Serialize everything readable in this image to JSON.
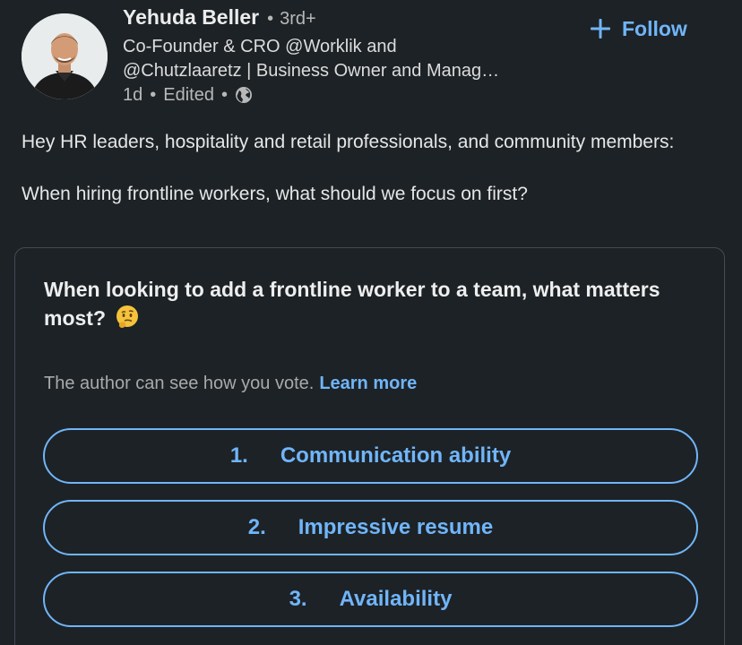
{
  "author": {
    "name": "Yehuda Beller",
    "degree_separator": "•",
    "degree": "3rd+",
    "headline_line1": "Co-Founder & CRO @Worklik and",
    "headline_line2": "@Chutzlaaretz | Business Owner and Manag…",
    "time": "1d",
    "edited": "Edited",
    "meta_separator": "•",
    "visibility_icon": "globe-icon"
  },
  "follow": {
    "label": "Follow",
    "icon": "plus-icon"
  },
  "post": {
    "line1": "Hey HR leaders, hospitality and retail professionals, and community members:",
    "line2": "When hiring frontline workers, what should we focus on first?"
  },
  "poll": {
    "question": "When looking to add a frontline worker to a team, what matters most?",
    "question_emoji": "thinking-face-emoji-icon",
    "privacy_note": "The author can see how you vote.",
    "learn_more": "Learn more",
    "options": [
      {
        "number": "1.",
        "label": "Communication ability"
      },
      {
        "number": "2.",
        "label": "Impressive resume"
      },
      {
        "number": "3.",
        "label": "Availability"
      }
    ]
  },
  "colors": {
    "background": "#1d2226",
    "accent": "#70b5f9",
    "text": "#e6e6e6",
    "muted": "#b8b8b8",
    "border": "#444b52"
  }
}
